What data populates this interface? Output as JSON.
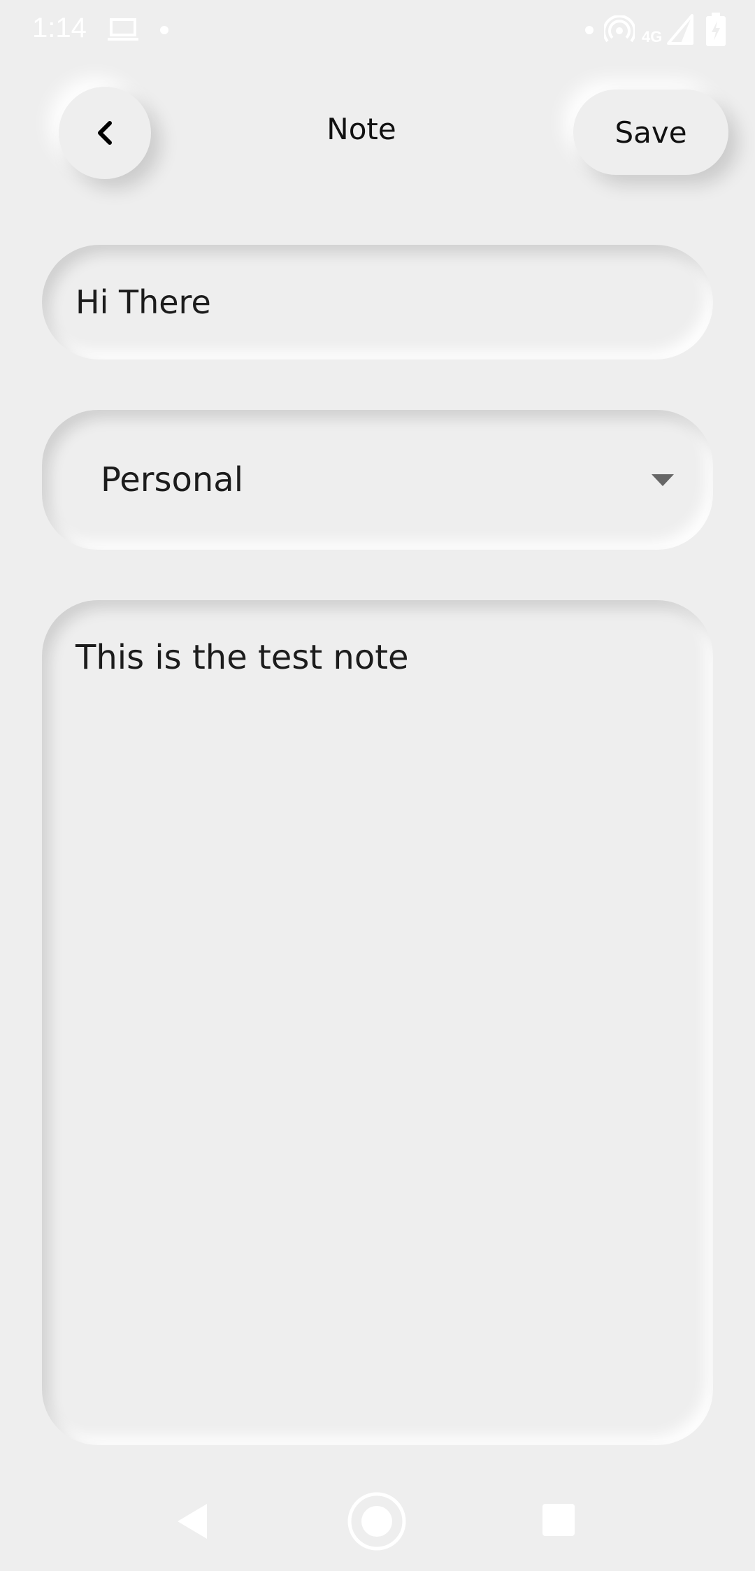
{
  "status_bar": {
    "time": "1:14",
    "network_label": "4G",
    "icons": [
      "laptop-icon",
      "notification-dot-icon",
      "dot-icon",
      "hotspot-icon",
      "signal-icon",
      "battery-charging-icon"
    ]
  },
  "header": {
    "title": "Note",
    "back_icon": "chevron-left-icon",
    "save_label": "Save"
  },
  "form": {
    "title_value": "Hi There",
    "category_selected": "Personal",
    "note_body": "This is the test note"
  },
  "nav_bar": {
    "icons": [
      "nav-back-icon",
      "nav-home-icon",
      "nav-recents-icon"
    ]
  },
  "colors": {
    "background": "#eeeeee",
    "text": "#1c1c1c",
    "status_icons": "#ffffff"
  }
}
